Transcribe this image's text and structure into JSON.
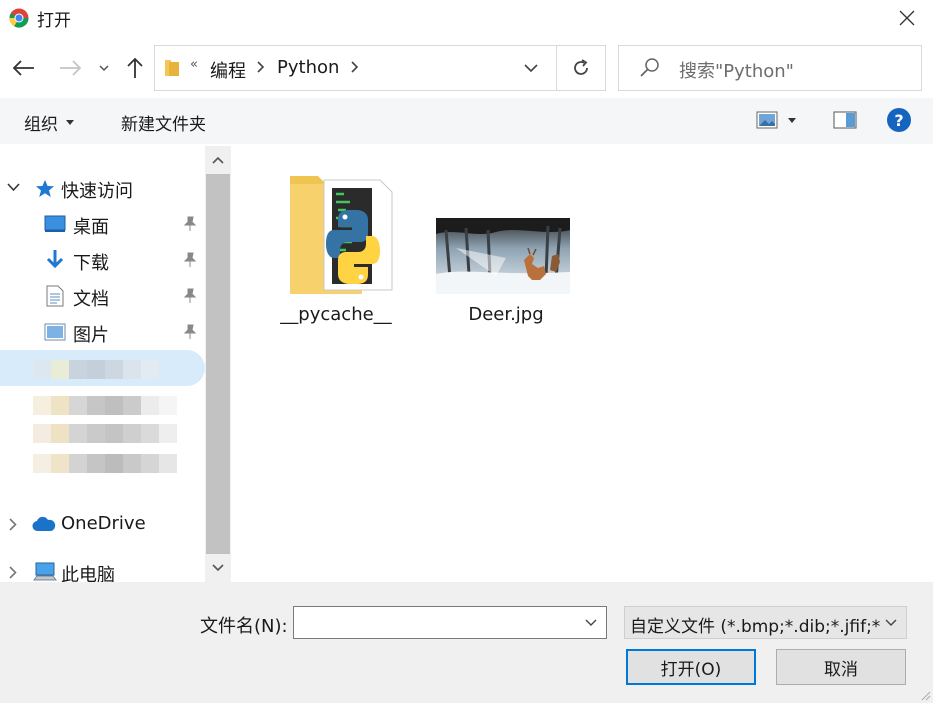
{
  "window": {
    "title": "打开"
  },
  "address": {
    "overflow": "«",
    "crumbs": [
      "编程",
      "Python"
    ],
    "search_placeholder": "搜索\"Python\""
  },
  "toolbar": {
    "organize": "组织",
    "new_folder": "新建文件夹",
    "help": "?"
  },
  "sidebar": {
    "quick_access": "快速访问",
    "items": [
      {
        "label": "桌面",
        "icon": "desktop-icon"
      },
      {
        "label": "下载",
        "icon": "download-icon"
      },
      {
        "label": "文档",
        "icon": "document-icon"
      },
      {
        "label": "图片",
        "icon": "picture-icon"
      }
    ],
    "onedrive": "OneDrive",
    "this_pc": "此电脑"
  },
  "files": [
    {
      "name": "__pycache__",
      "type": "folder"
    },
    {
      "name": "Deer.jpg",
      "type": "image"
    }
  ],
  "bottom": {
    "filename_label": "文件名(N):",
    "filename_value": "",
    "filetype_value": "自定义文件 (*.bmp;*.dib;*.jfif;*",
    "open_label": "打开(O)",
    "cancel_label": "取消"
  },
  "colors": {
    "accent": "#0078d7",
    "help": "#1565c0",
    "folder": "#f4c657"
  }
}
